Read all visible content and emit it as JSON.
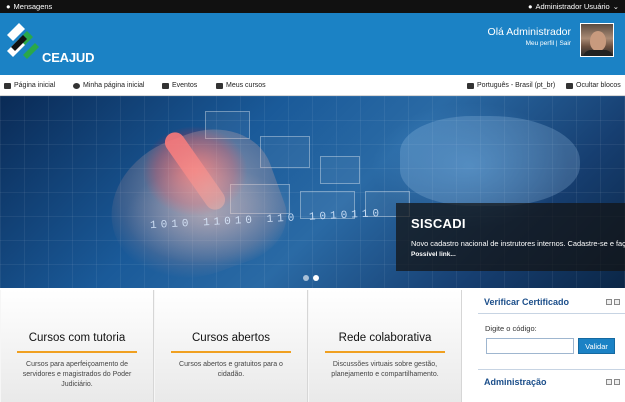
{
  "topbar": {
    "messages": "Mensagens",
    "user": "Administrador Usuário"
  },
  "header": {
    "logo_text": "CEAJUD",
    "greeting": "Olá Administrador",
    "profile_link": "Meu perfil",
    "separator": "|",
    "logout_link": "Sair"
  },
  "nav": {
    "items": [
      {
        "label": "Página inicial",
        "icon": "home-icon"
      },
      {
        "label": "Minha página inicial",
        "icon": "dashboard-icon"
      },
      {
        "label": "Eventos",
        "icon": "calendar-icon"
      },
      {
        "label": "Meus cursos",
        "icon": "folder-icon"
      }
    ],
    "language": "Português - Brasil (pt_br)",
    "hide_blocks": "Ocultar blocos"
  },
  "banner": {
    "binary_text": "1010 11010 110 1010110",
    "caption_title": "SISCADI",
    "caption_text": "Novo cadastro nacional de instrutores internos. Cadastre-se e faça sua",
    "caption_link": "Possível link...",
    "slides": 2,
    "active_slide": 2
  },
  "features": [
    {
      "title": "Cursos com tutoria",
      "text": "Cursos para aperfeiçoamento de servidores e magistrados do Poder Judiciário."
    },
    {
      "title": "Cursos abertos",
      "text": "Cursos abertos e gratuitos para o cidadão."
    },
    {
      "title": "Rede colaborativa",
      "text": "Discussões virtuais sobre gestão, planejamento e compartilhamento."
    }
  ],
  "sidebar": {
    "certificate_title": "Verificar Certificado",
    "code_label": "Digite o código:",
    "code_value": "",
    "validate_button": "Validar",
    "admin_title": "Administração"
  },
  "colors": {
    "brand_blue": "#1b82c5",
    "topbar": "#111111",
    "accent_orange": "#f0a020"
  }
}
